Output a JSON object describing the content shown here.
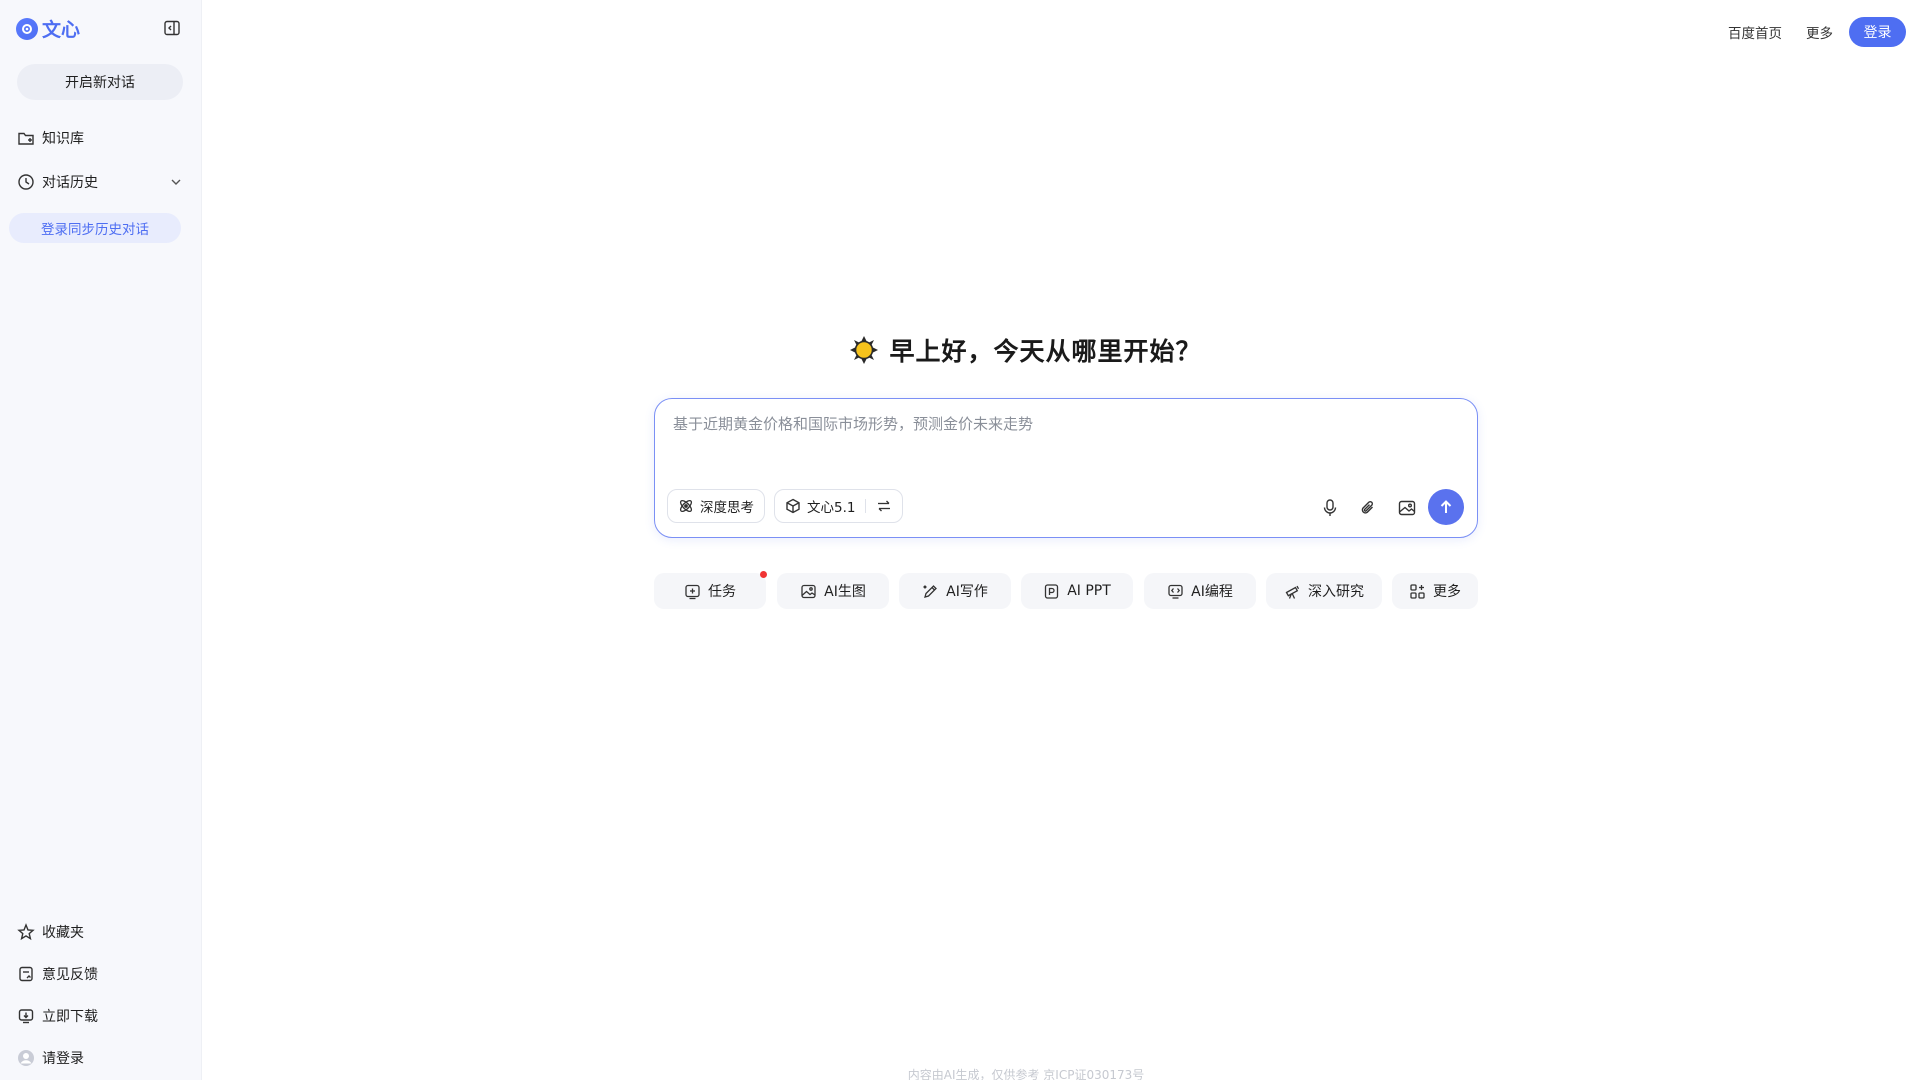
{
  "sidebar": {
    "logo_text": "文心",
    "new_chat_label": "开启新对话",
    "knowledge_base_label": "知识库",
    "history_label": "对话历史",
    "login_sync_label": "登录同步历史对话",
    "favorites_label": "收藏夹",
    "feedback_label": "意见反馈",
    "download_label": "立即下载",
    "login_prompt_label": "请登录"
  },
  "header": {
    "baidu_home_label": "百度首页",
    "more_label": "更多",
    "login_label": "登录"
  },
  "main": {
    "greeting": "早上好，今天从哪里开始？",
    "input_placeholder": "基于近期黄金价格和国际市场形势，预测金价未来走势",
    "deep_think_label": "深度思考",
    "model_label": "文心5.1",
    "quick_actions": [
      {
        "label": "任务",
        "icon": "task-icon"
      },
      {
        "label": "AI生图",
        "icon": "image-gen-icon"
      },
      {
        "label": "AI写作",
        "icon": "pen-icon"
      },
      {
        "label": "AI PPT",
        "icon": "ppt-icon"
      },
      {
        "label": "AI编程",
        "icon": "code-icon"
      },
      {
        "label": "深入研究",
        "icon": "telescope-icon"
      },
      {
        "label": "更多",
        "icon": "grid-icon"
      }
    ]
  },
  "footer": {
    "text": "内容由AI生成，仅供参考  京ICP证030173号"
  },
  "colors": {
    "accent": "#4e6ef2",
    "sidebar_bg": "#f7f8fc",
    "notification_dot": "#f03434"
  }
}
